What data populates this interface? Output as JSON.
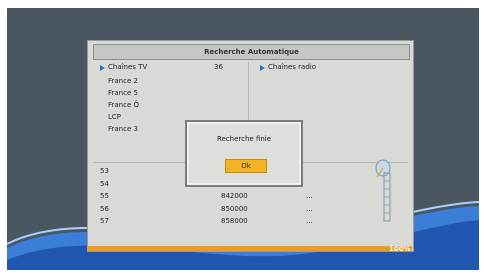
{
  "title": "Recherche Automatique",
  "tv_channels": {
    "label": "Chaînes TV",
    "count": "36",
    "items": [
      "France 2",
      "France 5",
      "France Ô",
      "LCP",
      "France 3"
    ]
  },
  "radio_channels": {
    "label": "Chaînes radio"
  },
  "scan_table": [
    {
      "channel": "53",
      "frequency": "",
      "status": ""
    },
    {
      "channel": "54",
      "frequency": "",
      "status": ""
    },
    {
      "channel": "55",
      "frequency": "842000",
      "status": "..."
    },
    {
      "channel": "56",
      "frequency": "850000",
      "status": "..."
    },
    {
      "channel": "57",
      "frequency": "858000",
      "status": "..."
    }
  ],
  "dialog": {
    "message": "Recherche finie",
    "button_label": "Ok"
  },
  "progress": {
    "fraction": 1.0,
    "label": "100%"
  },
  "colors": {
    "accent": "#f09a1e",
    "button": "#f4b324",
    "marker": "#2b6fd6"
  },
  "icons": {
    "antenna": "satellite-dish-icon"
  }
}
